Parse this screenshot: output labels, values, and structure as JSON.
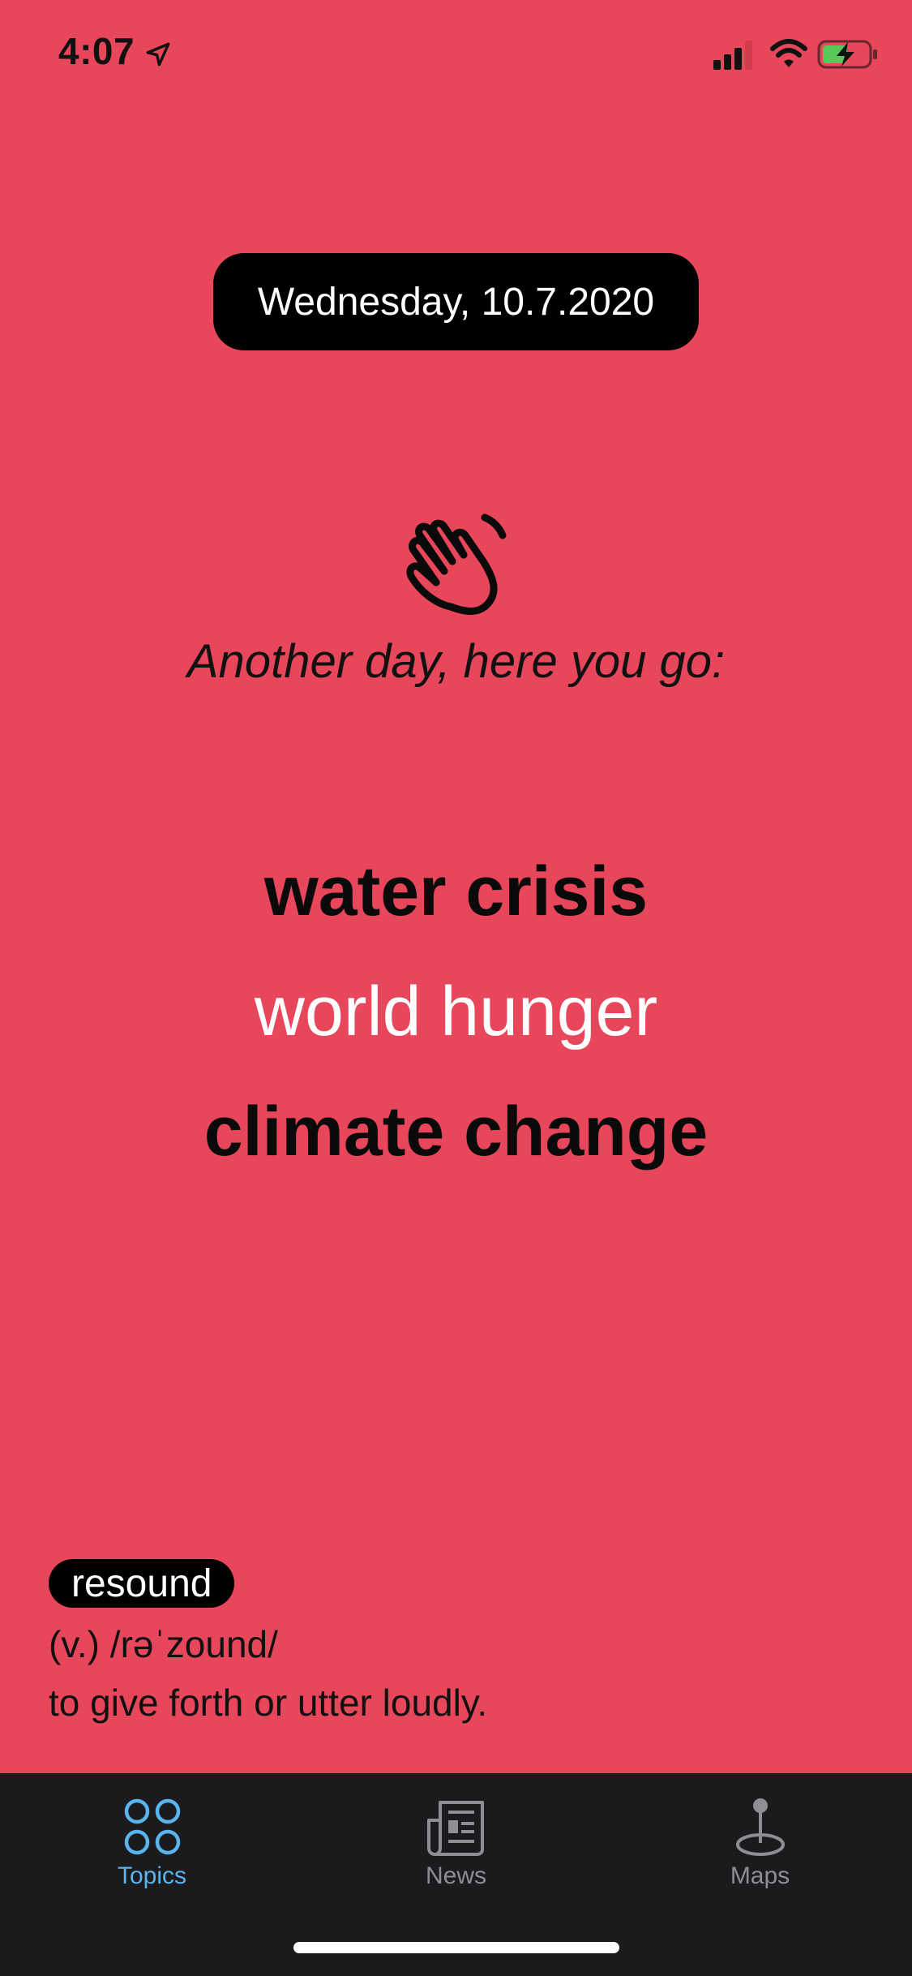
{
  "status_bar": {
    "time": "4:07",
    "icons": [
      "location-arrow-icon",
      "cellular-signal-icon",
      "wifi-icon",
      "battery-charging-icon"
    ]
  },
  "colors": {
    "background": "#E8465A",
    "pill": "#000000",
    "tab_bar": "#1B1B1D",
    "tab_active": "#5AB4F0",
    "tab_inactive": "#8E8E93"
  },
  "header": {
    "date": "Wednesday, 10.7.2020"
  },
  "greeting": {
    "icon": "waving-hand-icon",
    "text": "Another day, here you go:"
  },
  "topics": [
    {
      "label": "water crisis"
    },
    {
      "label": "world hunger"
    },
    {
      "label": "climate change"
    }
  ],
  "word_of_day": {
    "word": "resound",
    "pronunciation": "(v.) /rəˈzound/",
    "definition": "to give forth or utter loudly."
  },
  "tab_bar": {
    "tabs": [
      {
        "label": "Topics",
        "icon": "topics-grid-icon",
        "active": true
      },
      {
        "label": "News",
        "icon": "newspaper-icon",
        "active": false
      },
      {
        "label": "Maps",
        "icon": "map-pin-icon",
        "active": false
      }
    ]
  }
}
